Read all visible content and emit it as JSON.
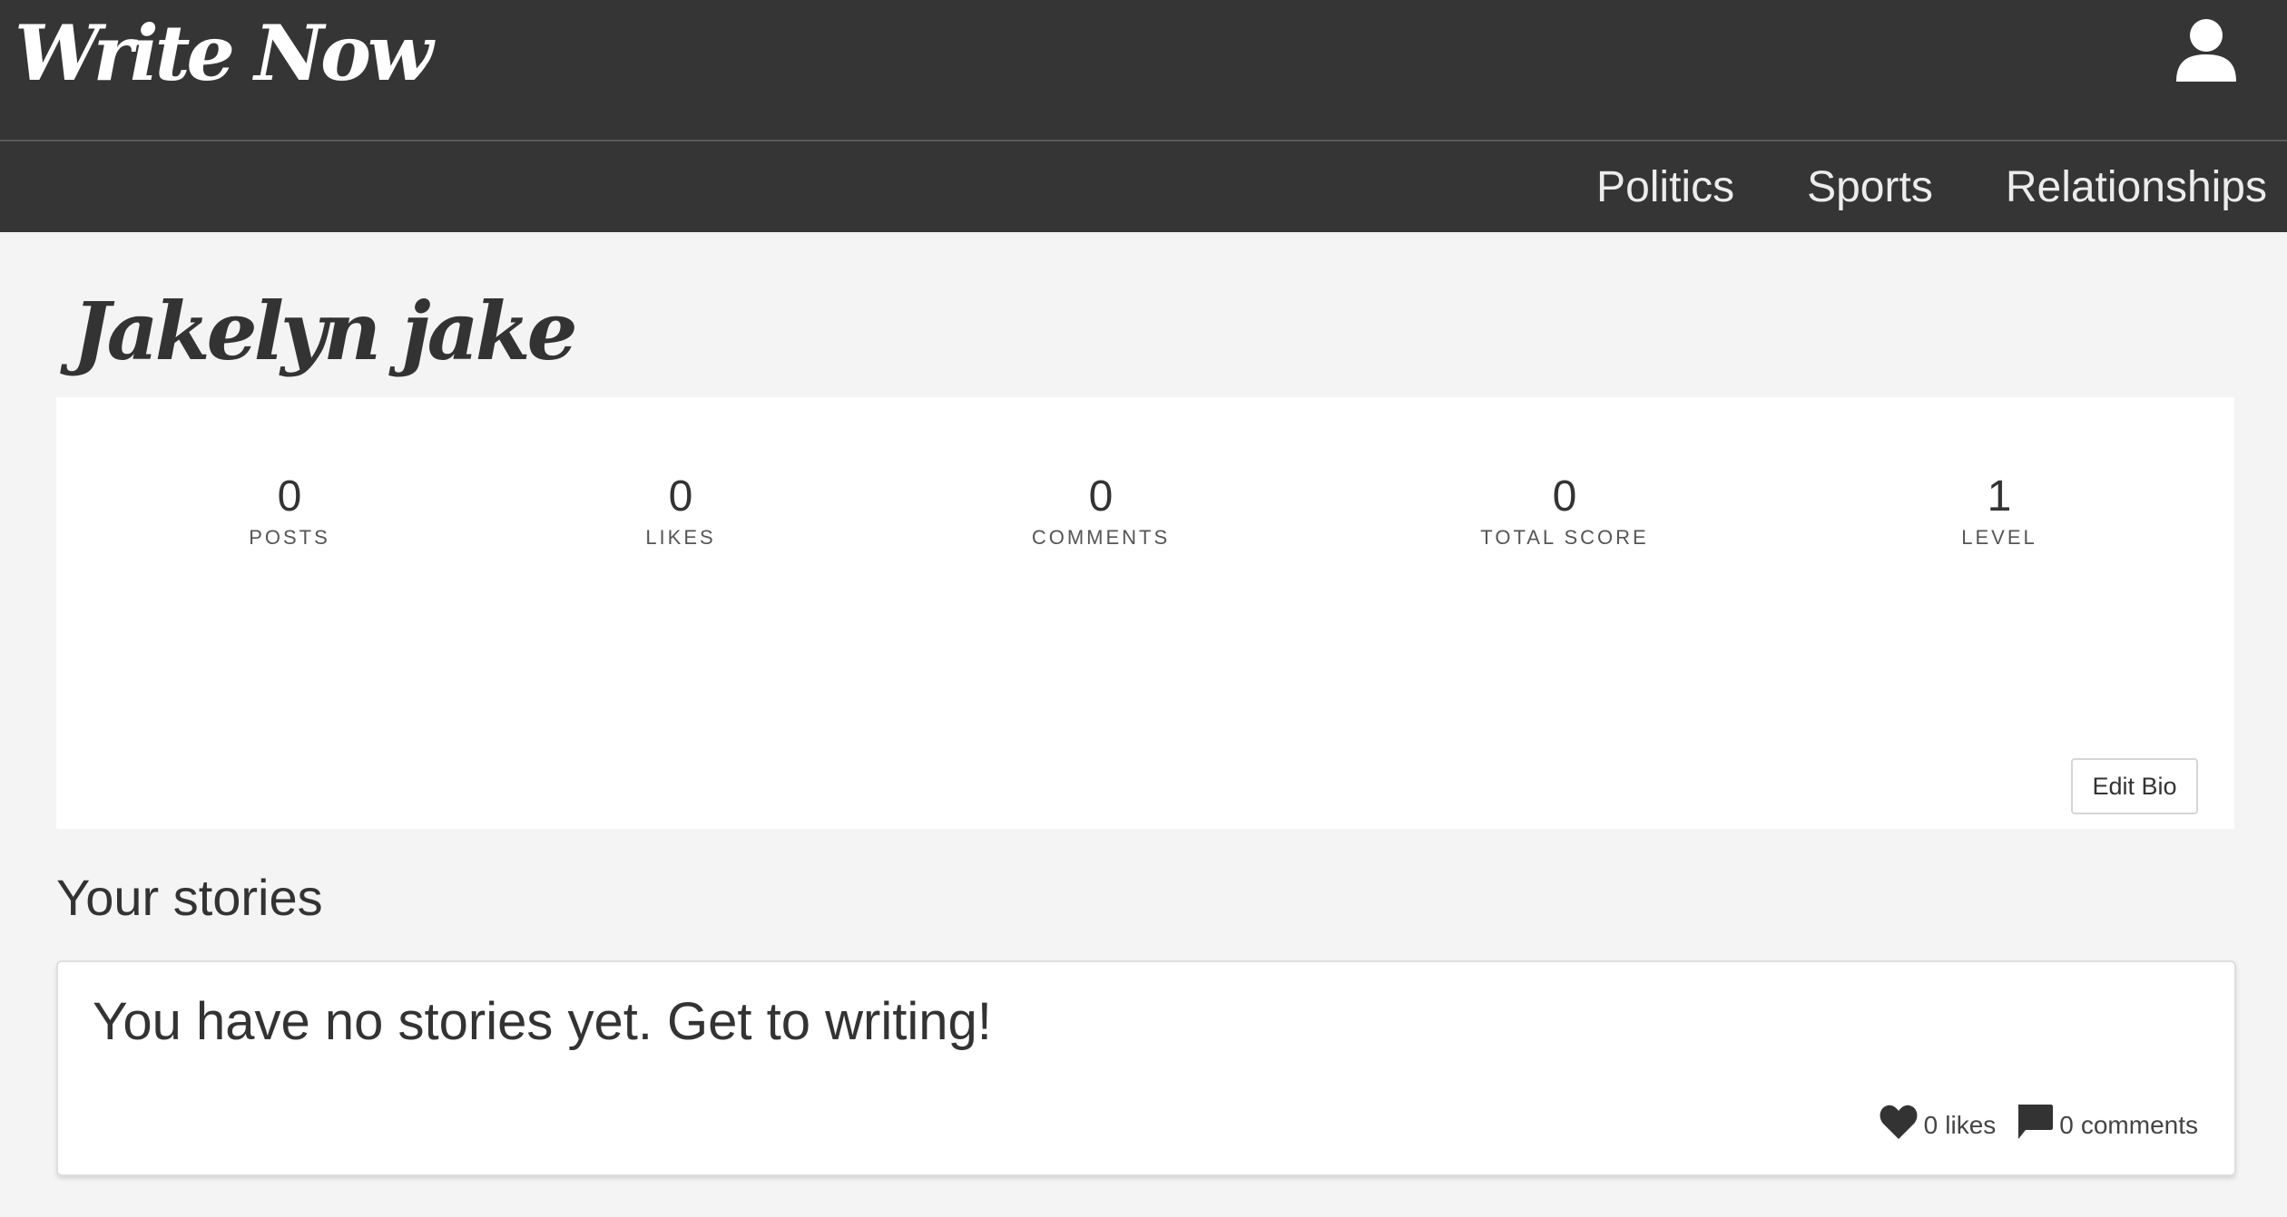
{
  "header": {
    "logo_text": "Write Now",
    "account_icon": "person-icon"
  },
  "nav": {
    "items": [
      {
        "label": "Politics"
      },
      {
        "label": "Sports"
      },
      {
        "label": "Relationships"
      }
    ]
  },
  "profile": {
    "name": "Jakelyn jake",
    "stats": [
      {
        "value": "0",
        "label": "POSTS"
      },
      {
        "value": "0",
        "label": "LIKES"
      },
      {
        "value": "0",
        "label": "COMMENTS"
      },
      {
        "value": "0",
        "label": "TOTAL SCORE"
      },
      {
        "value": "1",
        "label": "LEVEL"
      }
    ],
    "edit_bio_label": "Edit Bio"
  },
  "stories": {
    "title": "Your stories",
    "empty_message": "You have no stories yet. Get to writing!",
    "likes_count": "0",
    "likes_label": "likes",
    "comments_count": "0",
    "comments_label": "comments",
    "like_icon": "heart-icon",
    "comment_icon": "comment-icon"
  },
  "colors": {
    "header_bg": "#353535",
    "page_bg": "#f4f4f4",
    "panel_bg": "#ffffff",
    "text": "#333333"
  }
}
